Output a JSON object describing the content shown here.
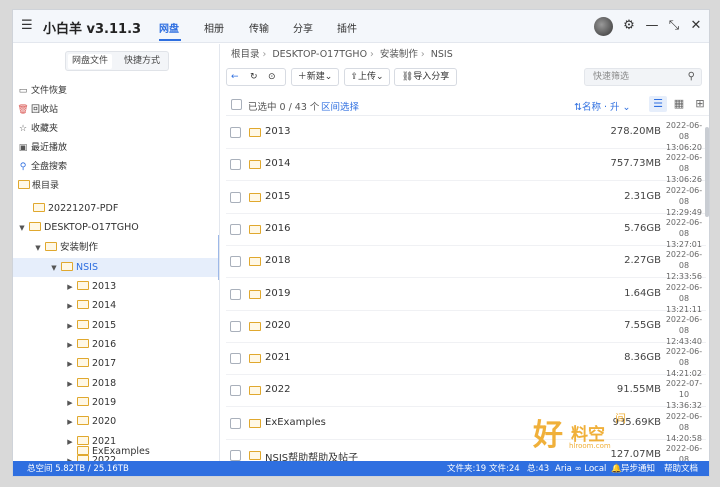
{
  "app": {
    "title": "小白羊 v3.11.3",
    "menu_icon": "hamburger-icon"
  },
  "tabs": [
    {
      "label": "网盘"
    },
    {
      "label": "相册"
    },
    {
      "label": "传输"
    },
    {
      "label": "分享"
    },
    {
      "label": "插件"
    }
  ],
  "left": {
    "tabs": {
      "files": "网盘文件",
      "shortcuts": "快捷方式"
    },
    "quick": [
      {
        "label": "文件恢复",
        "icon": "file-restore-icon"
      },
      {
        "label": "回收站",
        "icon": "trash-icon"
      },
      {
        "label": "收藏夹",
        "icon": "star-icon"
      },
      {
        "label": "最近播放",
        "icon": "play-icon"
      },
      {
        "label": "全盘搜索",
        "icon": "search-icon"
      },
      {
        "label": "根目录",
        "icon": "folder-icon"
      }
    ],
    "tree": [
      {
        "label": "20221207-PDF"
      },
      {
        "label": "DESKTOP-O17TGHO"
      },
      {
        "label": "安装制作"
      },
      {
        "label": "NSIS"
      },
      {
        "label": "2013"
      },
      {
        "label": "2014"
      },
      {
        "label": "2015"
      },
      {
        "label": "2016"
      },
      {
        "label": "2017"
      },
      {
        "label": "2018"
      },
      {
        "label": "2019"
      },
      {
        "label": "2020"
      },
      {
        "label": "2021"
      },
      {
        "label": "2022"
      },
      {
        "label": "ExExamples"
      }
    ]
  },
  "breadcrumb": [
    "根目录",
    "DESKTOP-O17TGHO",
    "安装制作",
    "NSIS"
  ],
  "toolbar": {
    "new": "新建",
    "upload": "上传",
    "import_share": "导入分享",
    "filter_placeholder": "快速筛选"
  },
  "selection": {
    "count": "已选中 0 / 43 个",
    "range": "区间选择",
    "sort": "名称 · 升"
  },
  "files": [
    {
      "name": "2013",
      "size": "278.20MB",
      "date": "2022-06-08",
      "time": "13:06:20"
    },
    {
      "name": "2014",
      "size": "757.73MB",
      "date": "2022-06-08",
      "time": "13:06:26"
    },
    {
      "name": "2015",
      "size": "2.31GB",
      "date": "2022-06-08",
      "time": "12:29:49"
    },
    {
      "name": "2016",
      "size": "5.76GB",
      "date": "2022-06-08",
      "time": "13:27:01"
    },
    {
      "name": "2018",
      "size": "2.27GB",
      "date": "2022-06-08",
      "time": "12:33:56"
    },
    {
      "name": "2019",
      "size": "1.64GB",
      "date": "2022-06-08",
      "time": "13:21:11"
    },
    {
      "name": "2020",
      "size": "7.55GB",
      "date": "2022-06-08",
      "time": "12:43:40"
    },
    {
      "name": "2021",
      "size": "8.36GB",
      "date": "2022-06-08",
      "time": "14:21:02"
    },
    {
      "name": "2022",
      "size": "91.55MB",
      "date": "2022-07-10",
      "time": "13:36:32"
    },
    {
      "name": "ExExamples",
      "size": "935.69KB",
      "date": "2022-06-08",
      "time": "14:20:58"
    },
    {
      "name": "NSIS帮助帮助及帖子",
      "size": "127.07MB",
      "date": "2022-06-08",
      "time": ""
    }
  ],
  "status": {
    "space": "总空间 5.82TB / 25.16TB",
    "folders": "文件夹:19",
    "files": "文件:24",
    "total": "总:43",
    "aria": "Aria ∞ Local",
    "sync": "异步通知",
    "help": "帮助文档"
  },
  "watermark": {
    "big": "好",
    "mid": "料空",
    "small": "间",
    "url": "hlroom.com"
  },
  "colors": {
    "accent": "#2f6fe0",
    "folder": "#e0a82e",
    "status_bar": "#2f6fe0"
  }
}
